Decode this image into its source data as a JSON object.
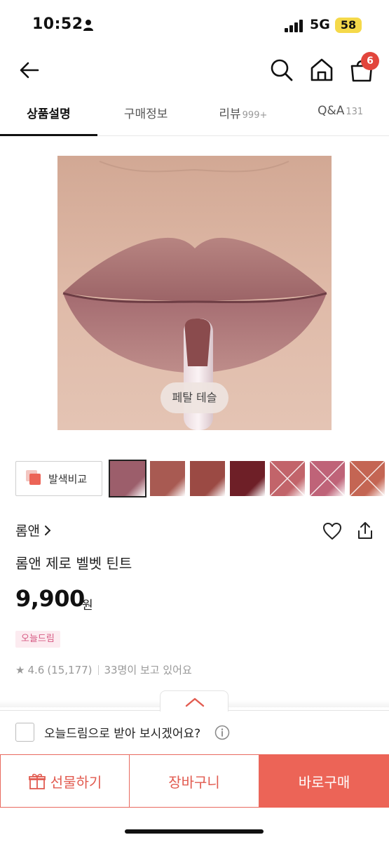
{
  "status_bar": {
    "time": "10:52",
    "network": "5G",
    "battery": "58"
  },
  "header": {
    "cart_count": "6"
  },
  "tabs": [
    {
      "label": "상품설명",
      "count": ""
    },
    {
      "label": "구매정보",
      "count": ""
    },
    {
      "label": "리뷰",
      "count": "999+"
    },
    {
      "label": "Q&A",
      "count": "131"
    }
  ],
  "product_image": {
    "color_label": "페탈 테슬"
  },
  "swatches": {
    "compare_label": "발색비교",
    "items": [
      {
        "color": "#9c5e6b",
        "selected": true,
        "sold_out": false
      },
      {
        "color": "#a85a52",
        "selected": false,
        "sold_out": false
      },
      {
        "color": "#9b4a44",
        "selected": false,
        "sold_out": false
      },
      {
        "color": "#6e1f27",
        "selected": false,
        "sold_out": false
      },
      {
        "color": "#c2646a",
        "selected": false,
        "sold_out": true
      },
      {
        "color": "#bf6378",
        "selected": false,
        "sold_out": true
      },
      {
        "color": "#c46553",
        "selected": false,
        "sold_out": true
      }
    ]
  },
  "product": {
    "brand": "롬앤",
    "name": "롬앤 제로 벨벳 틴트",
    "price": "9,900",
    "price_unit": "원",
    "delivery_badge": "오늘드림",
    "rating": "4.6",
    "review_count": "(15,177)",
    "viewers": "33명이 보고 있어요"
  },
  "bottom": {
    "today_delivery_question": "오늘드림으로 받아 보시겠어요?",
    "gift_label": "선물하기",
    "cart_label": "장바구니",
    "buy_label": "바로구매"
  },
  "colors": {
    "accent": "#ec6457",
    "badge_pink": "#d65a83",
    "cart_badge": "#e2453c"
  }
}
